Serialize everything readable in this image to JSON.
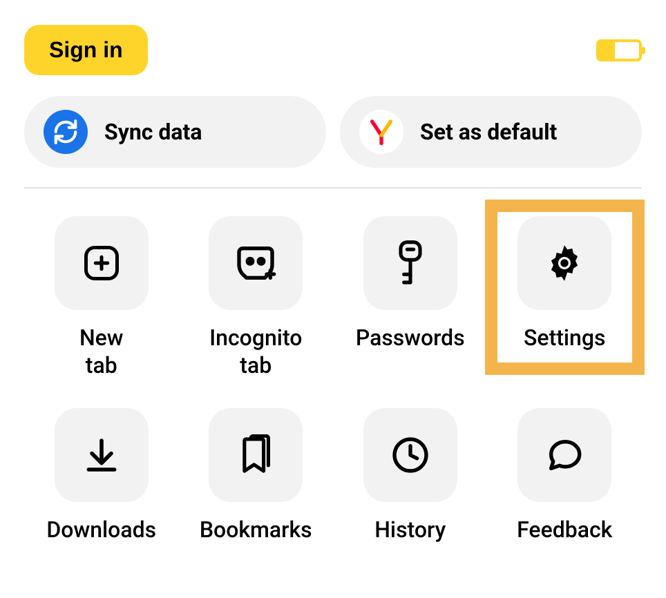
{
  "topbar": {
    "signin_label": "Sign in"
  },
  "battery": {
    "level_percent": 40
  },
  "pills": {
    "sync": {
      "label": "Sync data"
    },
    "default": {
      "label": "Set as default"
    }
  },
  "tiles": {
    "new_tab": {
      "label": "New\ntab"
    },
    "incognito": {
      "label": "Incognito\ntab"
    },
    "passwords": {
      "label": "Passwords"
    },
    "settings": {
      "label": "Settings"
    },
    "downloads": {
      "label": "Downloads"
    },
    "bookmarks": {
      "label": "Bookmarks"
    },
    "history": {
      "label": "History"
    },
    "feedback": {
      "label": "Feedback"
    }
  },
  "colors": {
    "accent_yellow": "#ffd42a",
    "sync_blue": "#1a73e8",
    "highlight_orange": "#f4b44c",
    "tile_bg": "#f2f2f2"
  },
  "highlighted_tile": "settings"
}
